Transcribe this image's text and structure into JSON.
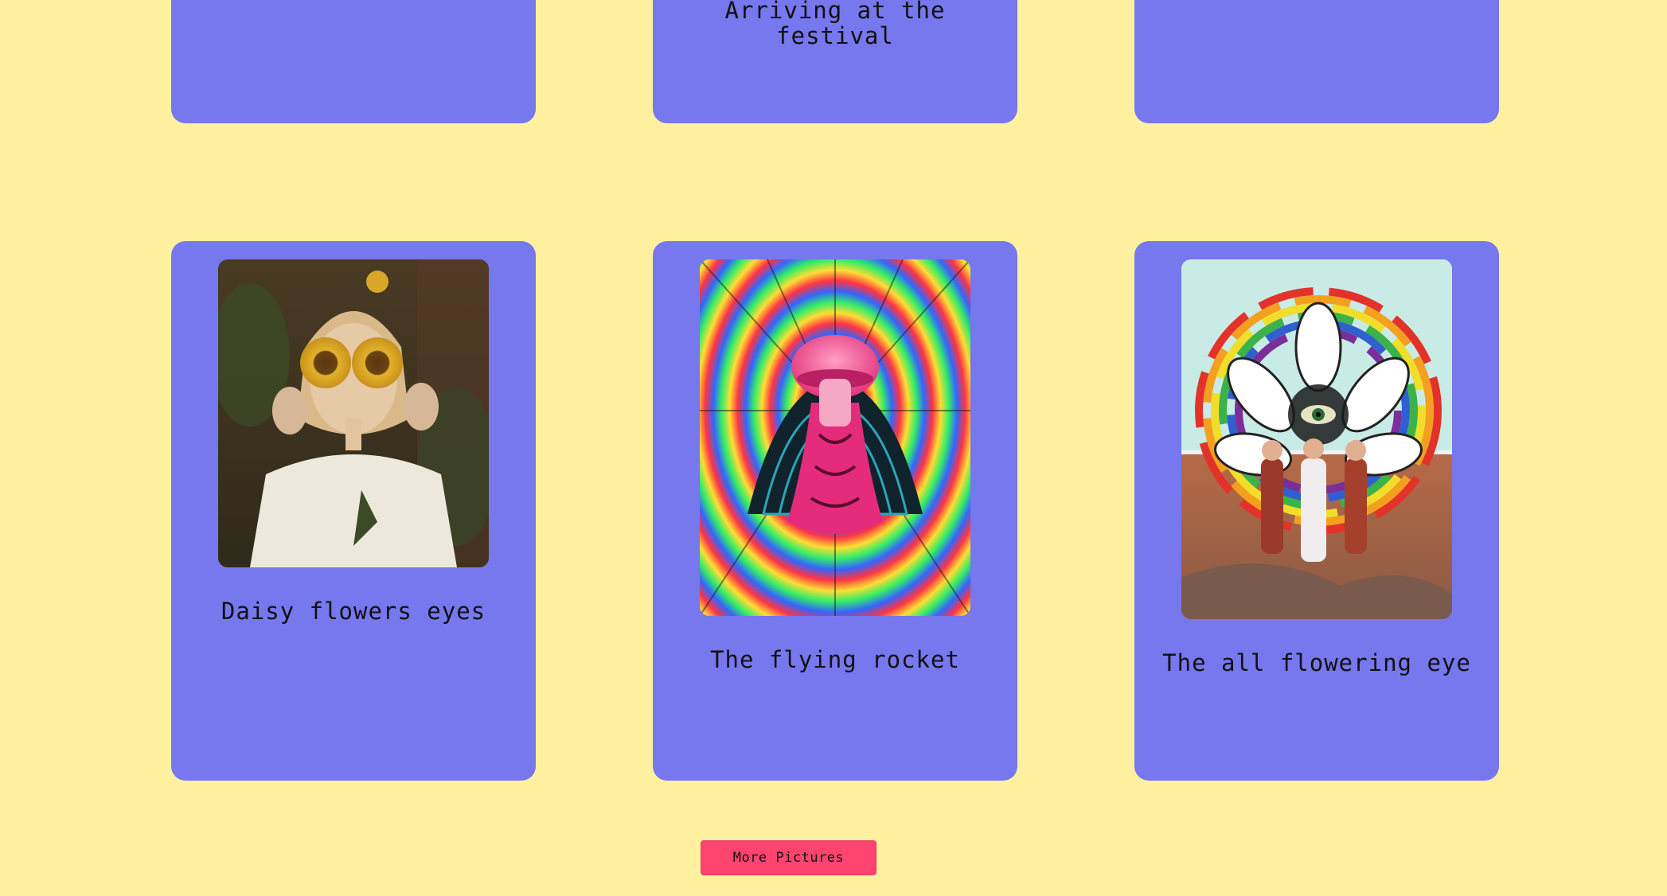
{
  "top_row": {
    "captions": [
      "",
      "Arriving at the\nfestival",
      ""
    ]
  },
  "gallery": {
    "cards": [
      {
        "caption": "Daisy flowers eyes",
        "image_icon": "sunflower-eyes-photo"
      },
      {
        "caption": "The flying rocket",
        "image_icon": "psychedelic-mushroom-art"
      },
      {
        "caption": "The all flowering eye",
        "image_icon": "rainbow-eye-collage"
      }
    ]
  },
  "more_button": {
    "label": "More Pictures"
  },
  "colors": {
    "background": "#fff1a0",
    "card": "#7777ee",
    "button": "#ff4470"
  }
}
